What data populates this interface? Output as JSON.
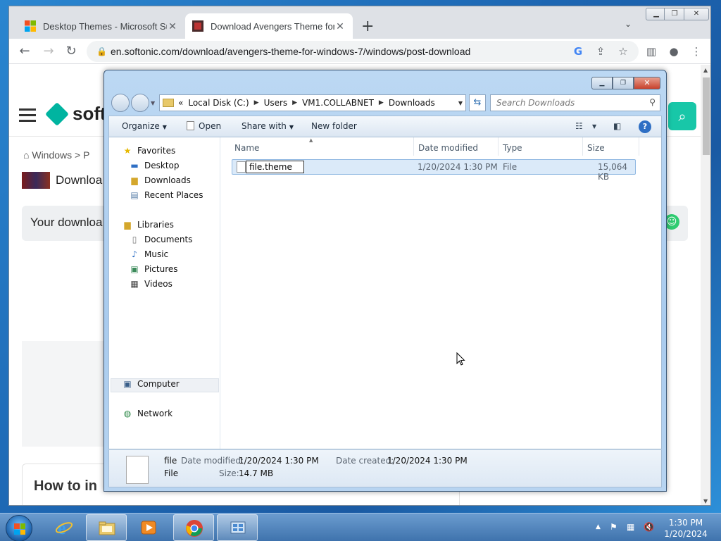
{
  "chrome": {
    "tabs": [
      {
        "title": "Desktop Themes - Microsoft Sup",
        "close": "✕"
      },
      {
        "title": "Download Avengers Theme for W",
        "close": "✕"
      }
    ],
    "new_tab": "+",
    "tab_search": "⌄",
    "url": "en.softonic.com/download/avengers-theme-for-windows-7/windows/post-download"
  },
  "page": {
    "logo": "softo",
    "breadcrumb": "Windows > P",
    "title": "Downloa",
    "download_banner": "Your downloa",
    "how_to": "How to in"
  },
  "explorer": {
    "address": {
      "prefix": "«",
      "segments": [
        "Local Disk (C:)",
        "Users",
        "VM1.COLLABNET",
        "Downloads"
      ]
    },
    "search_placeholder": "Search Downloads",
    "commands": {
      "organize": "Organize",
      "open": "Open",
      "share_with": "Share with",
      "new_folder": "New folder"
    },
    "nav": {
      "favorites": "Favorites",
      "desktop": "Desktop",
      "downloads": "Downloads",
      "recent_places": "Recent Places",
      "libraries": "Libraries",
      "documents": "Documents",
      "music": "Music",
      "pictures": "Pictures",
      "videos": "Videos",
      "computer": "Computer",
      "network": "Network"
    },
    "columns": {
      "name": "Name",
      "date_modified": "Date modified",
      "type": "Type",
      "size": "Size"
    },
    "file": {
      "rename_value": "file.theme",
      "date_modified": "1/20/2024 1:30 PM",
      "type": "File",
      "size": "15,064 KB"
    },
    "details": {
      "name": "file",
      "type": "File",
      "date_modified_label": "Date modified:",
      "date_modified": "1/20/2024 1:30 PM",
      "size_label": "Size:",
      "size": "14.7 MB",
      "date_created_label": "Date created:",
      "date_created": "1/20/2024 1:30 PM"
    }
  },
  "taskbar": {
    "time": "1:30 PM",
    "date": "1/20/2024"
  },
  "icons": {
    "accent_teal": "#18c7a8",
    "chrome_tab_bg": "#dee1e6"
  }
}
